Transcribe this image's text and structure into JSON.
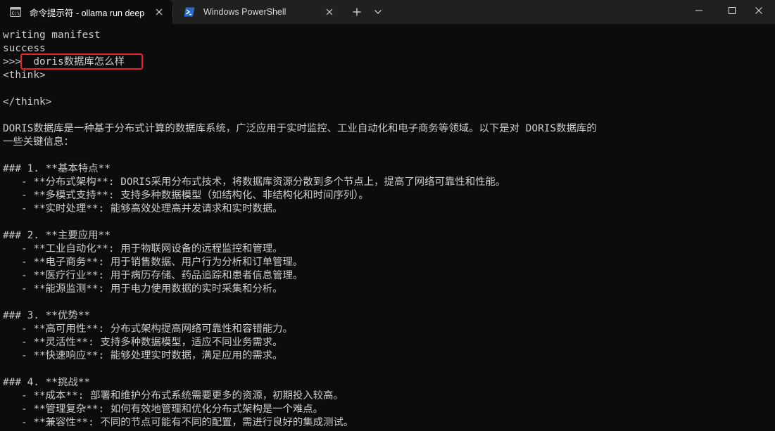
{
  "tabs": [
    {
      "title": "命令提示符 - ollama  run deep",
      "icon": "cmd-icon",
      "active": true
    },
    {
      "title": "Windows PowerShell",
      "icon": "powershell-icon",
      "active": false
    }
  ],
  "toolbar": {
    "new_tab": "new-tab-icon",
    "dropdown": "chevron-down-icon"
  },
  "window_controls": [
    "minimize-icon",
    "maximize-icon",
    "close-icon"
  ],
  "colors": {
    "background": "#0c0c0c",
    "text": "#cccccc",
    "titlebar": "#202020",
    "highlight": "#e8202a"
  },
  "terminal": {
    "lines": [
      "writing manifest",
      "success",
      ">>>  doris数据库怎么样",
      "<think>",
      "",
      "</think>",
      "",
      "DORIS数据库是一种基于分布式计算的数据库系统，广泛应用于实时监控、工业自动化和电子商务等领域。以下是对 DORIS数据库的",
      "一些关键信息：",
      "",
      "### 1. **基本特点**",
      "   - **分布式架构**: DORIS采用分布式技术，将数据库资源分散到多个节点上，提高了网络可靠性和性能。",
      "   - **多模式支持**: 支持多种数据模型（如结构化、非结构化和时间序列）。",
      "   - **实时处理**: 能够高效处理高并发请求和实时数据。",
      "",
      "### 2. **主要应用**",
      "   - **工业自动化**: 用于物联网设备的远程监控和管理。",
      "   - **电子商务**: 用于销售数据、用户行为分析和订单管理。",
      "   - **医疗行业**: 用于病历存储、药品追踪和患者信息管理。",
      "   - **能源监测**: 用于电力使用数据的实时采集和分析。",
      "",
      "### 3. **优势**",
      "   - **高可用性**: 分布式架构提高网络可靠性和容错能力。",
      "   - **灵活性**: 支持多种数据模型，适应不同业务需求。",
      "   - **快速响应**: 能够处理实时数据，满足应用的需求。",
      "",
      "### 4. **挑战**",
      "   - **成本**: 部署和维护分布式系统需要更多的资源，初期投入较高。",
      "   - **管理复杂**: 如何有效地管理和优化分布式架构是一个难点。",
      "   - **兼容性**: 不同的节点可能有不同的配置，需进行良好的集成测试。"
    ]
  }
}
